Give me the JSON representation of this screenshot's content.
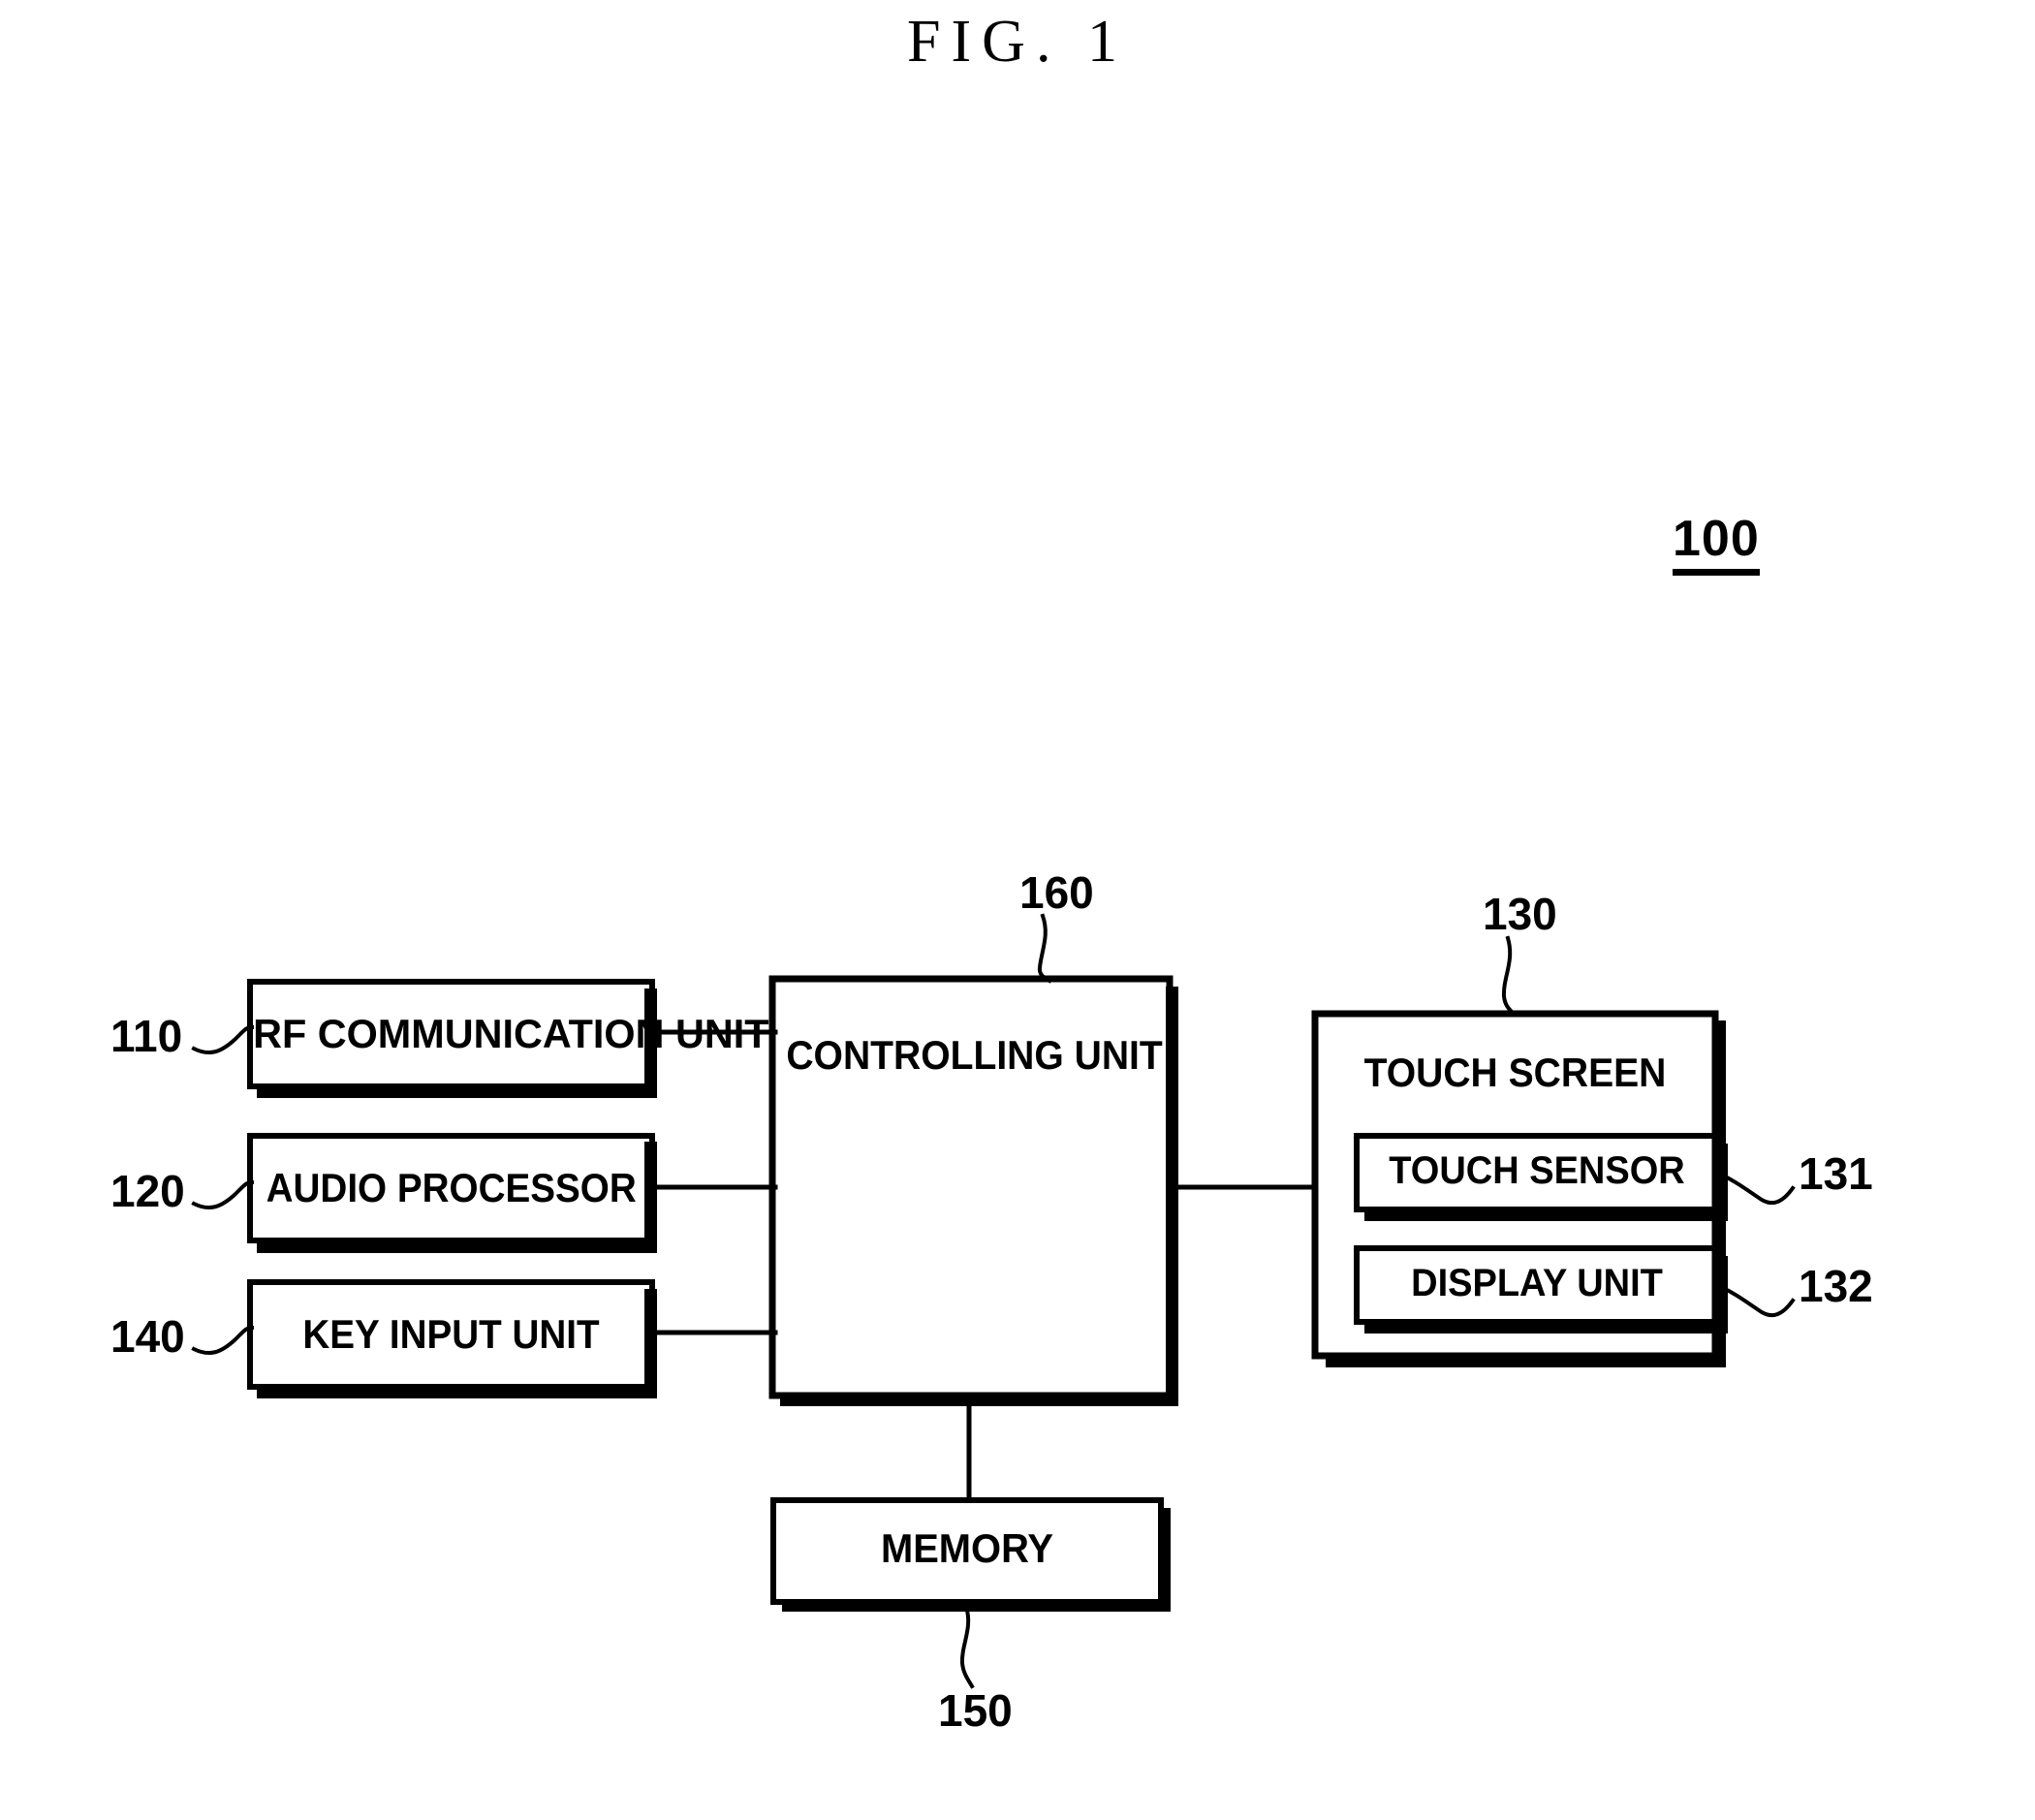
{
  "figure": {
    "title": "FIG. 1",
    "system_ref": "100"
  },
  "blocks": {
    "rf_communication_unit": {
      "label": "RF COMMUNICATION UNIT",
      "ref": "110"
    },
    "audio_processor": {
      "label": "AUDIO PROCESSOR",
      "ref": "120"
    },
    "key_input_unit": {
      "label": "KEY INPUT UNIT",
      "ref": "140"
    },
    "controlling_unit": {
      "label": "CONTROLLING UNIT",
      "ref": "160"
    },
    "memory": {
      "label": "MEMORY",
      "ref": "150"
    },
    "touch_screen": {
      "label": "TOUCH SCREEN",
      "ref": "130"
    },
    "touch_sensor": {
      "label": "TOUCH SENSOR",
      "ref": "131"
    },
    "display_unit": {
      "label": "DISPLAY UNIT",
      "ref": "132"
    }
  },
  "colors": {
    "ink": "#000000",
    "paper": "#ffffff"
  },
  "diagram_data": {
    "type": "block-diagram",
    "nodes": [
      {
        "id": "110",
        "label": "RF COMMUNICATION UNIT"
      },
      {
        "id": "120",
        "label": "AUDIO PROCESSOR"
      },
      {
        "id": "140",
        "label": "KEY INPUT UNIT"
      },
      {
        "id": "160",
        "label": "CONTROLLING UNIT"
      },
      {
        "id": "150",
        "label": "MEMORY"
      },
      {
        "id": "130",
        "label": "TOUCH SCREEN"
      },
      {
        "id": "131",
        "label": "TOUCH SENSOR"
      },
      {
        "id": "132",
        "label": "DISPLAY UNIT"
      }
    ],
    "edges": [
      {
        "from": "110",
        "to": "160"
      },
      {
        "from": "120",
        "to": "160"
      },
      {
        "from": "140",
        "to": "160"
      },
      {
        "from": "160",
        "to": "150"
      },
      {
        "from": "160",
        "to": "130"
      }
    ],
    "containment": [
      {
        "parent": "130",
        "children": [
          "131",
          "132"
        ]
      }
    ]
  }
}
